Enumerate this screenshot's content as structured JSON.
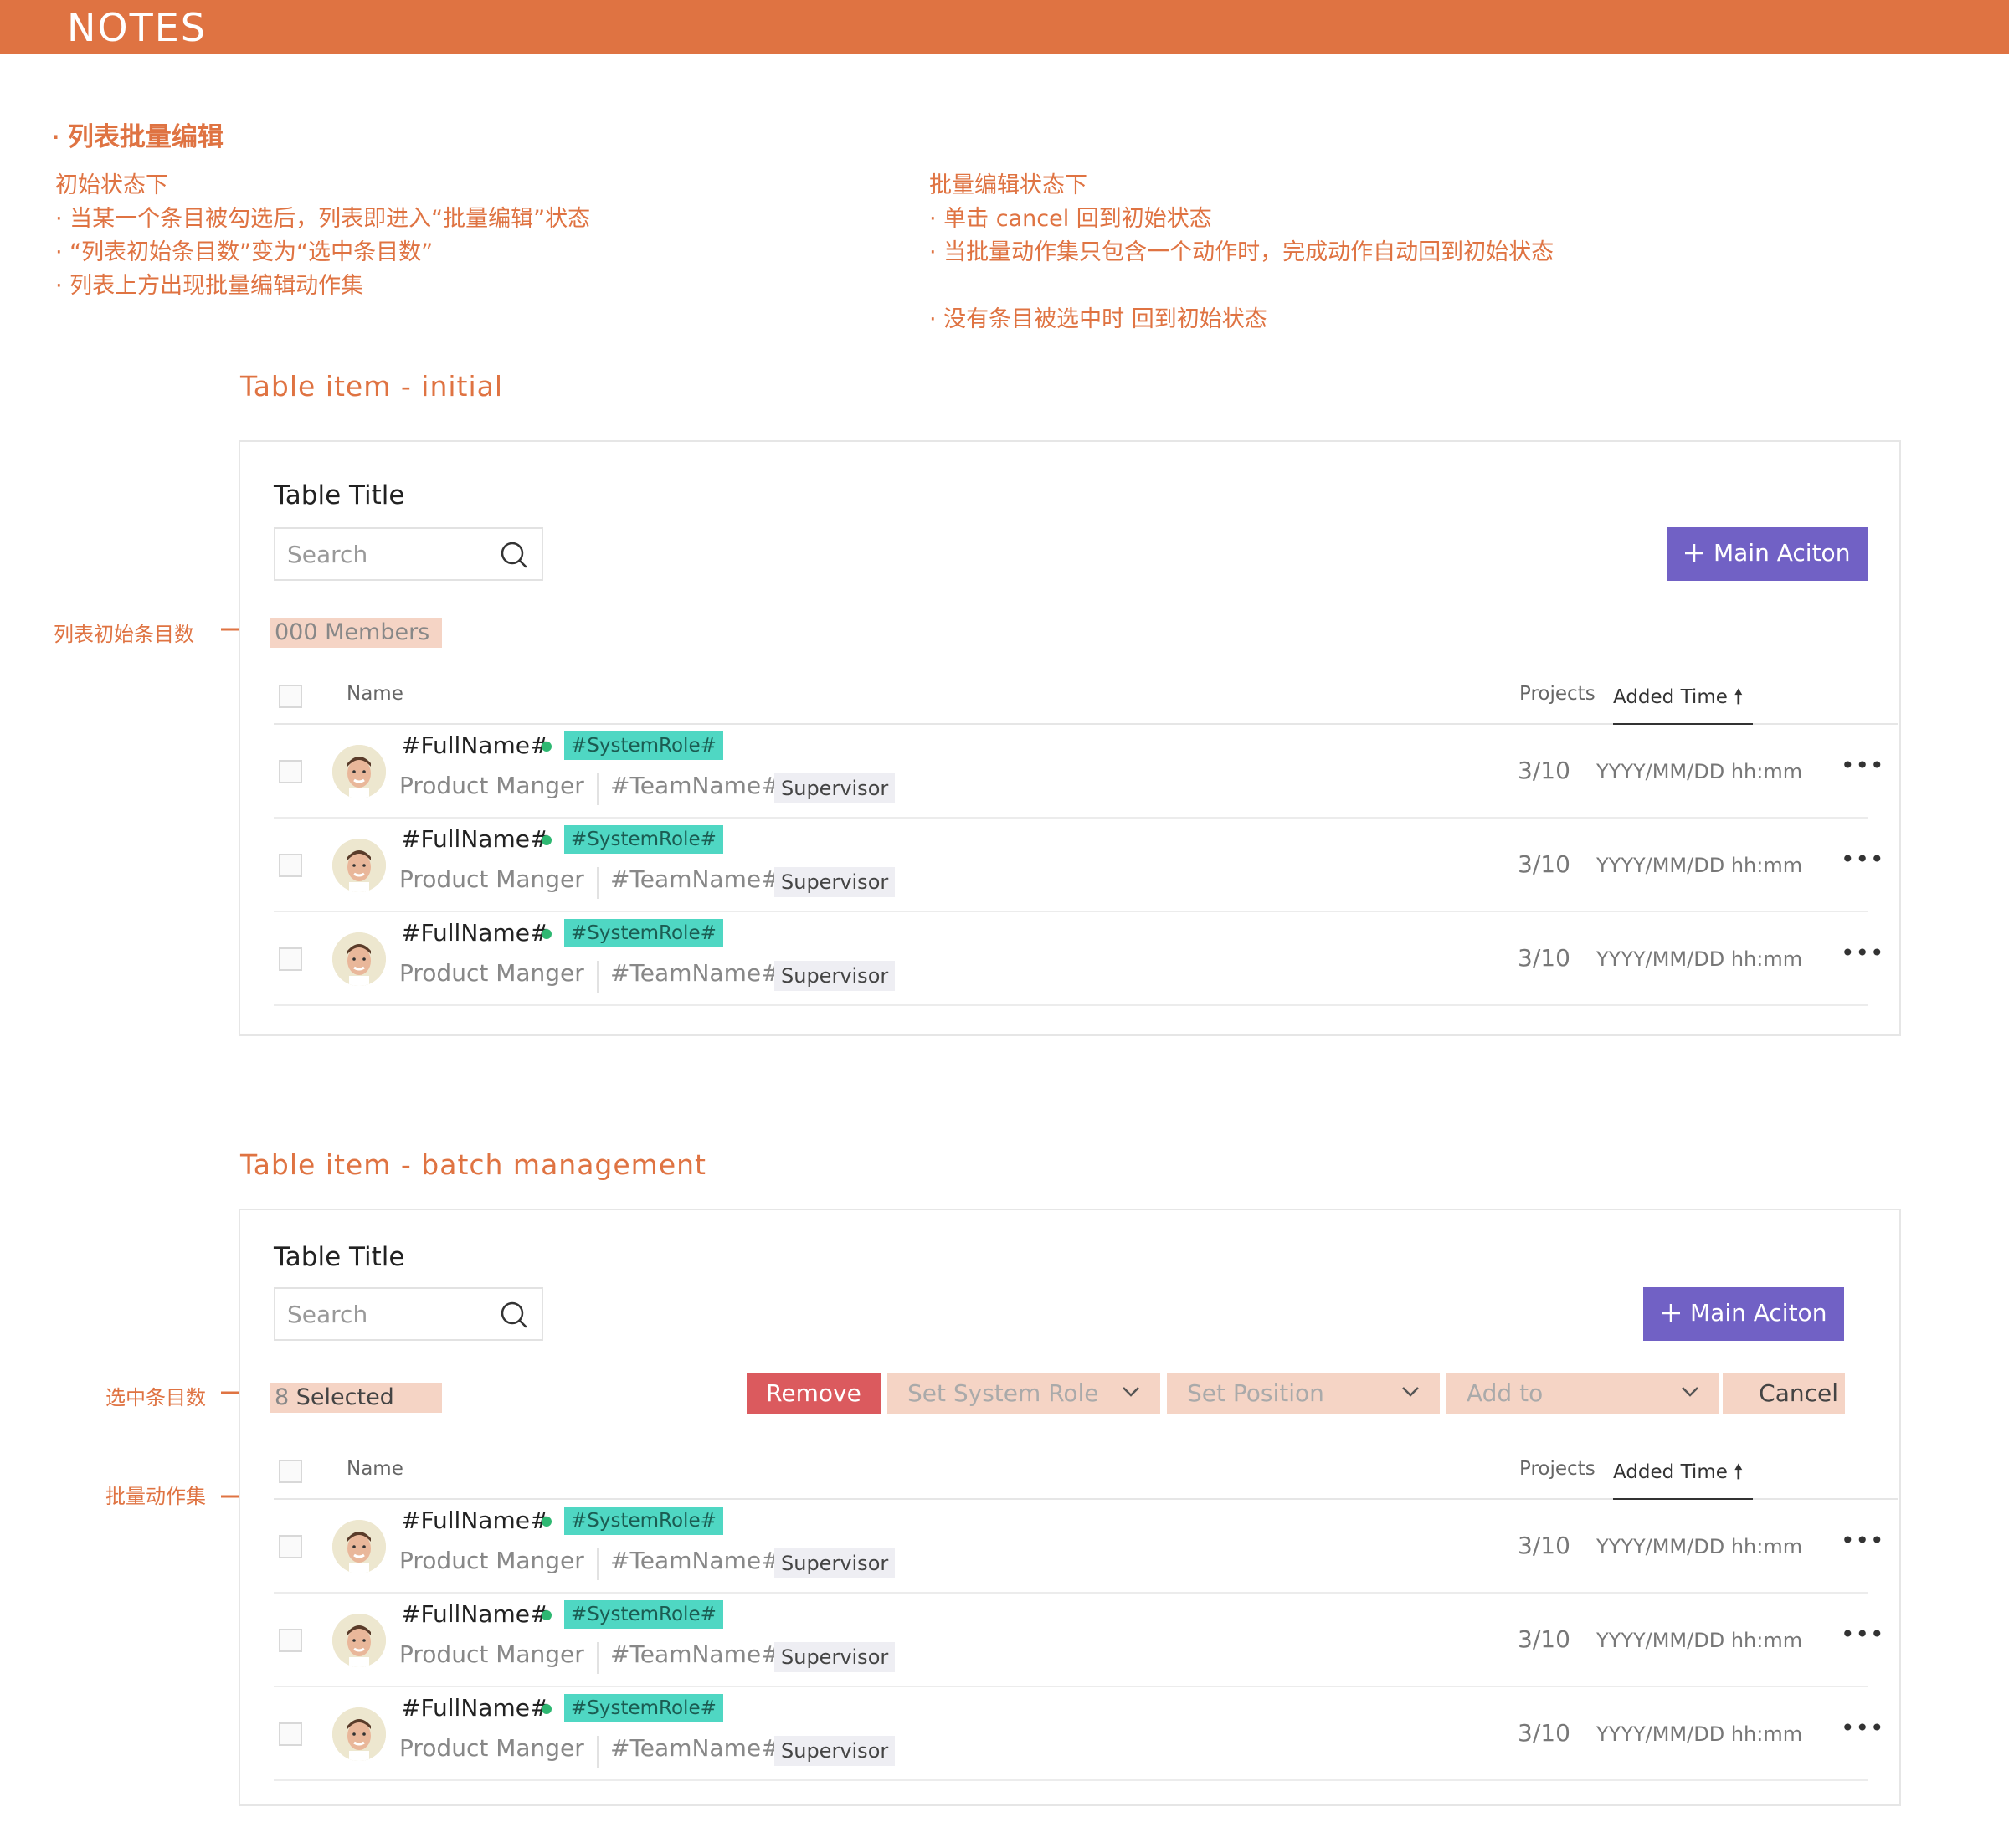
{
  "header": {
    "title": "NOTES"
  },
  "notes": {
    "heading": "· 列表批量编辑",
    "left_col": [
      "初始状态下",
      "· 当某一个条目被勾选后，列表即进入“批量编辑”状态",
      "· “列表初始条目数”变为“选中条目数”",
      "· 列表上方出现批量编辑动作集"
    ],
    "right_col": [
      "批量编辑状态下",
      "· 单击 cancel 回到初始状态",
      "· 当批量动作集只包含一个动作时，完成动作自动回到初始状态",
      "",
      "· 没有条目被选中时 回到初始状态"
    ]
  },
  "section_initial": {
    "title": "Table item - initial",
    "annotation": "列表初始条目数",
    "table": {
      "title": "Table Title",
      "search_placeholder": "Search",
      "main_action": "Main Aciton",
      "count_label": "000 Members",
      "columns": {
        "name": "Name",
        "projects": "Projects",
        "added_time": "Added Time",
        "sort_icon": "arrow-up-icon"
      },
      "rows": [
        {
          "full_name": "#FullName#",
          "system_role": "#SystemRole#",
          "position": "Product Manger",
          "team": "#TeamName#",
          "tag": "Supervisor",
          "projects": "3/10",
          "time": "YYYY/MM/DD hh:mm",
          "more": "•••"
        },
        {
          "full_name": "#FullName#",
          "system_role": "#SystemRole#",
          "position": "Product Manger",
          "team": "#TeamName#",
          "tag": "Supervisor",
          "projects": "3/10",
          "time": "YYYY/MM/DD hh:mm",
          "more": "•••"
        },
        {
          "full_name": "#FullName#",
          "system_role": "#SystemRole#",
          "position": "Product Manger",
          "team": "#TeamName#",
          "tag": "Supervisor",
          "projects": "3/10",
          "time": "YYYY/MM/DD hh:mm",
          "more": "•••"
        }
      ]
    }
  },
  "section_batch": {
    "title": "Table item - batch management",
    "annotation_count": "选中条目数",
    "annotation_actions": "批量动作集",
    "table": {
      "title": "Table Title",
      "search_placeholder": "Search",
      "main_action": "Main Aciton",
      "selected_count": "8",
      "selected_label": "Selected",
      "actions": {
        "remove": "Remove",
        "set_system_role": "Set System Role",
        "set_position": "Set Position",
        "add_to": "Add to",
        "cancel": "Cancel"
      },
      "columns": {
        "name": "Name",
        "projects": "Projects",
        "added_time": "Added Time",
        "sort_icon": "arrow-up-icon"
      },
      "rows": [
        {
          "full_name": "#FullName#",
          "system_role": "#SystemRole#",
          "position": "Product Manger",
          "team": "#TeamName#",
          "tag": "Supervisor",
          "projects": "3/10",
          "time": "YYYY/MM/DD hh:mm",
          "more": "•••"
        },
        {
          "full_name": "#FullName#",
          "system_role": "#SystemRole#",
          "position": "Product Manger",
          "team": "#TeamName#",
          "tag": "Supervisor",
          "projects": "3/10",
          "time": "YYYY/MM/DD hh:mm",
          "more": "•••"
        },
        {
          "full_name": "#FullName#",
          "system_role": "#SystemRole#",
          "position": "Product Manger",
          "team": "#TeamName#",
          "tag": "Supervisor",
          "projects": "3/10",
          "time": "YYYY/MM/DD hh:mm",
          "more": "•••"
        }
      ]
    }
  },
  "colors": {
    "accent_orange": "#DF7342",
    "primary_purple": "#7161C5",
    "danger_red": "#DB5A5E",
    "role_teal": "#4FD7C3",
    "online_green": "#2EB872",
    "highlight_peach": "#F5D4C5"
  }
}
